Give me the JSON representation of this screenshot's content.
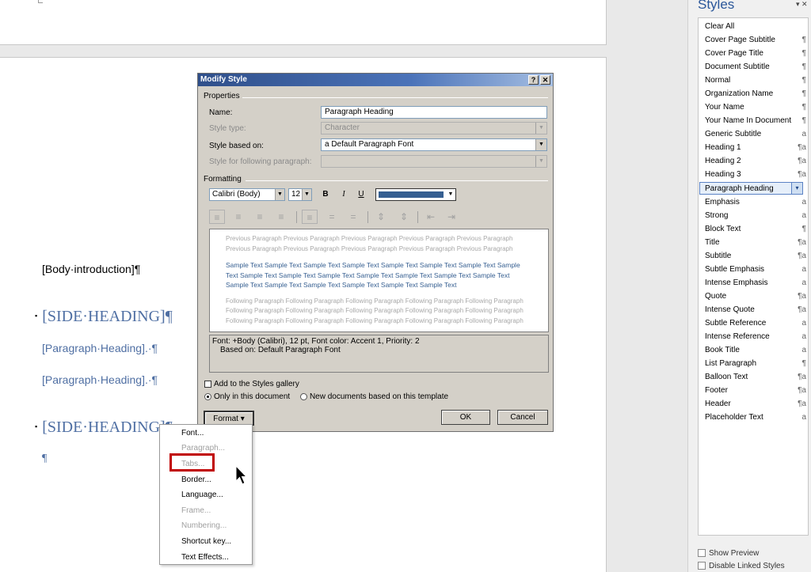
{
  "document": {
    "body_intro": "[Body·introduction]¶",
    "side_heading_1": "[SIDE·HEADING]¶",
    "para_heading_1": "[Paragraph·Heading].·¶",
    "para_heading_2": "[Paragraph·Heading].·¶",
    "side_heading_2": "[SIDE·HEADING]¶",
    "para_mark": "¶",
    "bullet": "▪"
  },
  "styles_pane": {
    "title": "Styles",
    "close": "▾ ✕",
    "items": [
      {
        "label": "Clear All",
        "mark": ""
      },
      {
        "label": "Cover Page Subtitle",
        "mark": "¶"
      },
      {
        "label": "Cover Page Title",
        "mark": "¶"
      },
      {
        "label": "Document Subtitle",
        "mark": "¶"
      },
      {
        "label": "Normal",
        "mark": "¶"
      },
      {
        "label": "Organization Name",
        "mark": "¶"
      },
      {
        "label": "Your Name",
        "mark": "¶"
      },
      {
        "label": "Your Name In Document",
        "mark": "¶"
      },
      {
        "label": "Generic Subtitle",
        "mark": "a"
      },
      {
        "label": "Heading 1",
        "mark": "¶a"
      },
      {
        "label": "Heading 2",
        "mark": "¶a"
      },
      {
        "label": "Heading 3",
        "mark": "¶a"
      },
      {
        "label": "Paragraph Heading",
        "mark": "▾"
      },
      {
        "label": "Emphasis",
        "mark": "a"
      },
      {
        "label": "Strong",
        "mark": "a"
      },
      {
        "label": "Block Text",
        "mark": "¶"
      },
      {
        "label": "Title",
        "mark": "¶a"
      },
      {
        "label": "Subtitle",
        "mark": "¶a"
      },
      {
        "label": "Subtle Emphasis",
        "mark": "a"
      },
      {
        "label": "Intense Emphasis",
        "mark": "a"
      },
      {
        "label": "Quote",
        "mark": "¶a"
      },
      {
        "label": "Intense Quote",
        "mark": "¶a"
      },
      {
        "label": "Subtle Reference",
        "mark": "a"
      },
      {
        "label": "Intense Reference",
        "mark": "a"
      },
      {
        "label": "Book Title",
        "mark": "a"
      },
      {
        "label": "List Paragraph",
        "mark": "¶"
      },
      {
        "label": "Balloon Text",
        "mark": "¶a"
      },
      {
        "label": "Footer",
        "mark": "¶a"
      },
      {
        "label": "Header",
        "mark": "¶a"
      },
      {
        "label": "Placeholder Text",
        "mark": "a"
      }
    ],
    "show_preview": "Show Preview",
    "disable_linked": "Disable Linked Styles"
  },
  "dialog": {
    "title": "Modify Style",
    "help_btn": "?",
    "close_btn": "✕",
    "properties_label": "Properties",
    "name_label": "Name:",
    "name_value": "Paragraph Heading",
    "style_type_label": "Style type:",
    "style_type_value": "Character",
    "based_on_label": "Style based on:",
    "based_on_value": "a  Default Paragraph Font",
    "following_label": "Style for following paragraph:",
    "following_value": "",
    "formatting_label": "Formatting",
    "font_value": "Calibri (Body)",
    "size_value": "12",
    "bold": "B",
    "italic": "I",
    "underline": "U",
    "font_color": "#365f91",
    "preview_prev": "Previous Paragraph Previous Paragraph Previous Paragraph Previous Paragraph Previous Paragraph Previous Paragraph Previous Paragraph Previous Paragraph Previous Paragraph Previous Paragraph",
    "preview_sample": "Sample Text Sample Text Sample Text Sample Text Sample Text Sample Text Sample Text Sample Text Sample Text Sample Text Sample Text Sample Text Sample Text Sample Text Sample Text Sample Text Sample Text Sample Text Sample Text Sample Text Sample Text",
    "preview_follow": "Following Paragraph Following Paragraph Following Paragraph Following Paragraph Following Paragraph Following Paragraph Following Paragraph Following Paragraph Following Paragraph Following Paragraph Following Paragraph Following Paragraph Following Paragraph Following Paragraph Following Paragraph",
    "desc_line1": "Font: +Body (Calibri), 12 pt, Font color: Accent 1, Priority: 2",
    "desc_line2": "Based on: Default Paragraph Font",
    "add_gallery": "Add to the Styles gallery",
    "only_doc": "Only in this document",
    "new_docs": "New documents based on this template",
    "format_btn": "Format ▾",
    "ok_btn": "OK",
    "cancel_btn": "Cancel"
  },
  "format_menu": {
    "items": [
      {
        "label": "Font...",
        "enabled": true
      },
      {
        "label": "Paragraph...",
        "enabled": false
      },
      {
        "label": "Tabs...",
        "enabled": false
      },
      {
        "label": "Border...",
        "enabled": true
      },
      {
        "label": "Language...",
        "enabled": true
      },
      {
        "label": "Frame...",
        "enabled": false
      },
      {
        "label": "Numbering...",
        "enabled": false
      },
      {
        "label": "Shortcut key...",
        "enabled": true
      },
      {
        "label": "Text Effects...",
        "enabled": true
      }
    ]
  }
}
